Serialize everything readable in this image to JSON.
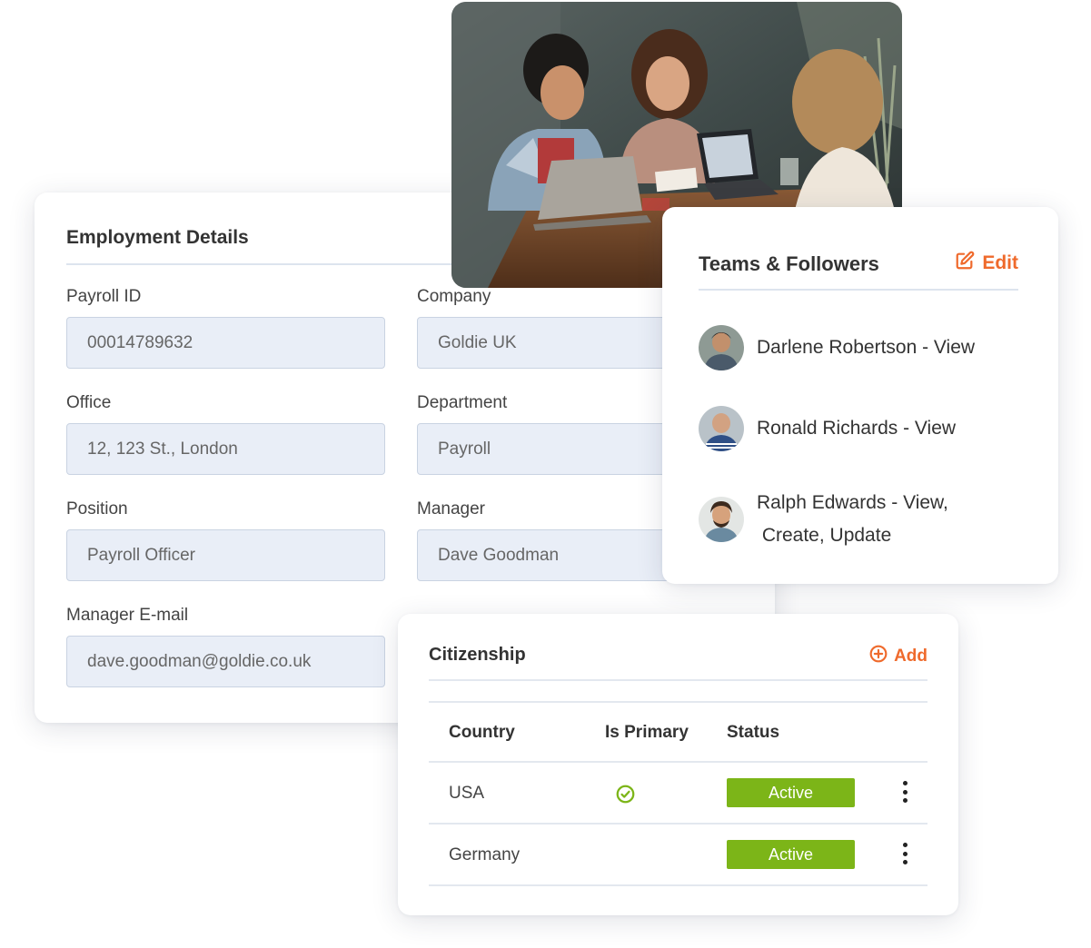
{
  "employment": {
    "title": "Employment Details",
    "fields": [
      {
        "label": "Payroll ID",
        "value": "00014789632"
      },
      {
        "label": "Company",
        "value": "Goldie UK"
      },
      {
        "label": "Office",
        "value": "12, 123 St., London"
      },
      {
        "label": "Department",
        "value": "Payroll"
      },
      {
        "label": "Position",
        "value": "Payroll Officer"
      },
      {
        "label": "Manager",
        "value": "Dave Goodman"
      },
      {
        "label": "Manager E-mail",
        "value": "dave.goodman@goldie.co.uk"
      }
    ]
  },
  "teams": {
    "title": "Teams & Followers",
    "edit_label": "Edit",
    "members": [
      {
        "line1": "Darlene Robertson - View",
        "line2": ""
      },
      {
        "line1": "Ronald Richards - View",
        "line2": ""
      },
      {
        "line1": "Ralph Edwards - View,",
        "line2": " Create, Update"
      }
    ]
  },
  "citizenship": {
    "title": "Citizenship",
    "add_label": "Add",
    "columns": [
      "Country",
      "Is Primary",
      "Status"
    ],
    "rows": [
      {
        "country": "USA",
        "is_primary": true,
        "status": "Active"
      },
      {
        "country": "Germany",
        "is_primary": false,
        "status": "Active"
      }
    ]
  },
  "colors": {
    "accent": "#ef6a2c",
    "active_badge": "#7cb518",
    "input_bg": "#e9eef7",
    "primary_check": "#7cb518"
  },
  "icons": {
    "edit": "edit-icon",
    "add": "add-circle-icon",
    "check": "check-circle-icon",
    "more": "kebab-menu-icon"
  }
}
